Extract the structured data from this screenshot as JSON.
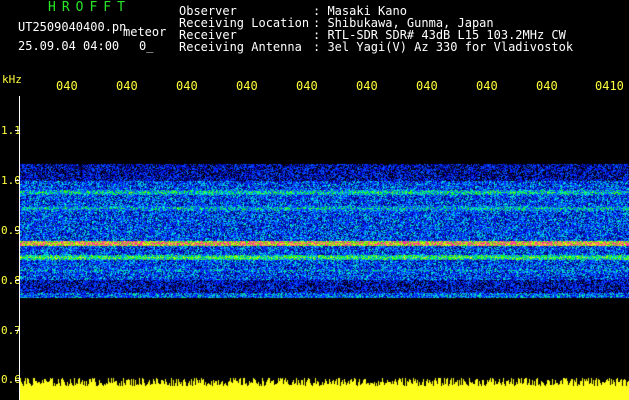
{
  "header": {
    "brand": "HROFFT",
    "filename": "UT2509040400.pn",
    "tag": "meteor",
    "datetime": "25.09.04 04:00",
    "zero": "0_",
    "fields": [
      {
        "label": "Observer",
        "value": ": Masaki Kano"
      },
      {
        "label": "Receiving Location",
        "value": ": Shibukawa, Gunma, Japan"
      },
      {
        "label": "Receiver",
        "value": ": RTL-SDR SDR# 43dB L15 103.2MHz CW"
      },
      {
        "label": "Receiving Antenna",
        "value": ": 3el Yagi(V) Az 330 for Vladivostok"
      }
    ]
  },
  "axes": {
    "unit": "kHz",
    "y_ticks": [
      "1.1",
      "1.0",
      "0.9",
      "0.8",
      "0.7",
      "0.6"
    ],
    "x_ticks": [
      "040",
      "040",
      "040",
      "040",
      "040",
      "040",
      "040",
      "040",
      "040",
      "0410"
    ]
  },
  "colors": {
    "white": "#ffffff",
    "yellow": "#ffff3c",
    "green": "#27e827"
  }
}
